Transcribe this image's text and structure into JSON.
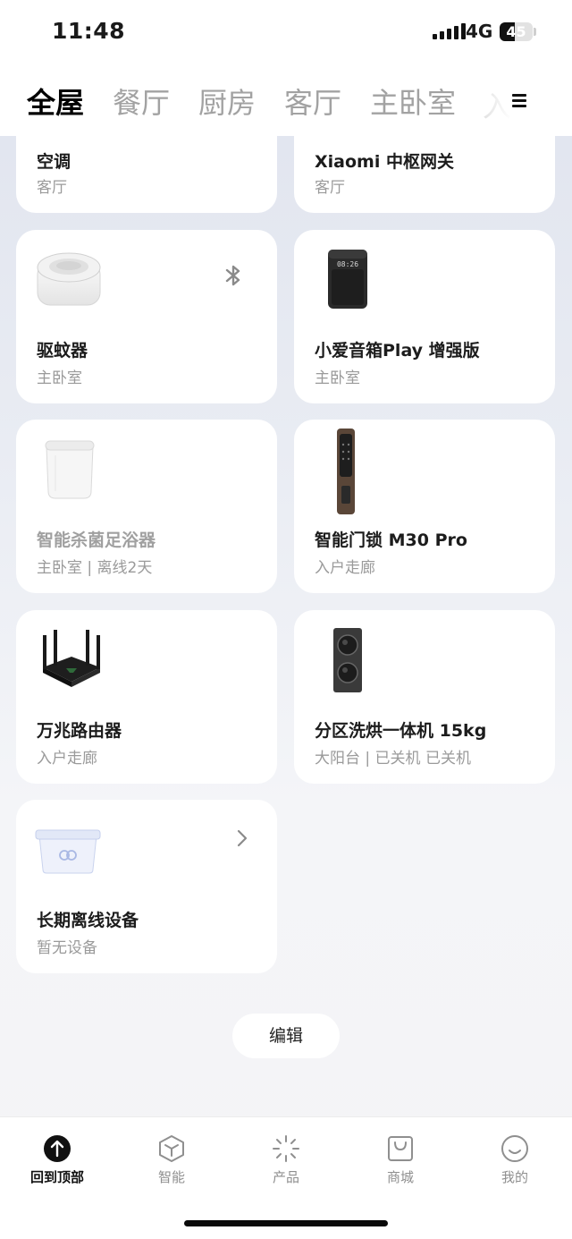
{
  "status_bar": {
    "time": "11:48",
    "network": "4G",
    "battery": "45",
    "battery_level": 0.45
  },
  "tabs": [
    {
      "label": "全屋",
      "active": true
    },
    {
      "label": "餐厅"
    },
    {
      "label": "厨房"
    },
    {
      "label": "客厅"
    },
    {
      "label": "主卧室"
    },
    {
      "label": "入"
    }
  ],
  "devices": [
    {
      "name": "空调",
      "room": "客厅"
    },
    {
      "name": "Xiaomi 中枢网关",
      "room": "客厅"
    },
    {
      "name": "驱蚊器",
      "room": "主卧室",
      "icon": "bluetooth-icon"
    },
    {
      "name": "小爱音箱Play 增强版",
      "room": "主卧室",
      "screen": "08:26"
    },
    {
      "name": "智能杀菌足浴器",
      "room": "主卧室 | 离线2天"
    },
    {
      "name": "智能门锁 M30 Pro",
      "room": "入户走廊"
    },
    {
      "name": "万兆路由器",
      "room": "入户走廊"
    },
    {
      "name": "分区洗烘一体机 15kg",
      "room": "大阳台 | 已关机 已关机"
    },
    {
      "name": "长期离线设备",
      "room": "暂无设备",
      "icon": "chevron-right-icon"
    }
  ],
  "edit_label": "编辑",
  "bottom_nav": [
    {
      "label": "回到顶部",
      "icon": "arrow-up-circle-icon",
      "active": true
    },
    {
      "label": "智能",
      "icon": "cube-icon"
    },
    {
      "label": "产品",
      "icon": "sparkle-icon"
    },
    {
      "label": "商城",
      "icon": "shopping-bag-icon"
    },
    {
      "label": "我的",
      "icon": "smile-icon"
    }
  ]
}
